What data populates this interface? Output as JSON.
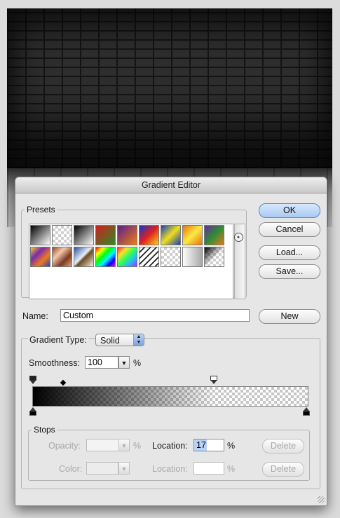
{
  "dialog": {
    "title": "Gradient Editor"
  },
  "presets": {
    "legend": "Presets",
    "menu_glyph": "▸",
    "swatches": [
      {
        "name": "foreground-to-background",
        "bg": "linear-gradient(135deg,#000 0%,#fff 100%)"
      },
      {
        "name": "foreground-to-transparent",
        "bg": "checker"
      },
      {
        "name": "black-white",
        "bg": "linear-gradient(135deg,#000,#fff)"
      },
      {
        "name": "red-green",
        "bg": "linear-gradient(135deg,#d02020,#2d8a22)"
      },
      {
        "name": "violet-orange",
        "bg": "linear-gradient(135deg,#5a1e8c,#f07d12)"
      },
      {
        "name": "blue-red-yellow",
        "bg": "linear-gradient(135deg,#1535c6,#e02020,#f5d21a)"
      },
      {
        "name": "blue-yellow-blue",
        "bg": "linear-gradient(135deg,#1540b8,#f0de1c,#1540b8)"
      },
      {
        "name": "orange-yellow-orange",
        "bg": "linear-gradient(135deg,#e8740c,#fbe944,#e8740c)"
      },
      {
        "name": "violet-green-orange",
        "bg": "linear-gradient(135deg,#6b2a9c,#2e8c36,#e47a1c)"
      },
      {
        "name": "yellow-violet-orange-blue",
        "bg": "linear-gradient(135deg,#f2d21a,#7a2ab0,#ef7a18,#1a48c8)"
      },
      {
        "name": "copper",
        "bg": "linear-gradient(135deg,#8a4a2a,#f4c9a9,#7a3a22,#e0a07c)"
      },
      {
        "name": "chrome",
        "bg": "linear-gradient(135deg,#2a4ea0,#e8eef8 45%,#6b4a22 55%,#f6f0e0)"
      },
      {
        "name": "spectrum",
        "bg": "linear-gradient(135deg,#ff0000,#ffff00,#00ff00,#00ffff,#0000ff,#ff00ff)"
      },
      {
        "name": "transparent-rainbow",
        "bg": "linear-gradient(135deg,#ff2a2a,#ffe12a,#2aff5a,#2ab4ff,#b42aff)"
      },
      {
        "name": "transparent-stripes",
        "bg": "repeating-linear-gradient(135deg,#fff 0 4px,#222 4px 6px)"
      },
      {
        "name": "neutral-density",
        "bg": "checker"
      },
      {
        "name": "white-to-gray",
        "bg": "linear-gradient(90deg,#fdfdfd,#a8a8a8)"
      },
      {
        "name": "black-to-transparent",
        "bg": "linear-gradient(135deg,#000 0%,rgba(0,0,0,0) 55%)"
      }
    ]
  },
  "buttons": {
    "ok": "OK",
    "cancel": "Cancel",
    "load": "Load...",
    "save": "Save...",
    "new": "New"
  },
  "name_field": {
    "label": "Name:",
    "value": "Custom"
  },
  "gradient_type": {
    "label": "Gradient Type:",
    "selected": "Solid",
    "smoothness_label": "Smoothness:",
    "smoothness_value": "100",
    "smoothness_unit": "%"
  },
  "stops": {
    "legend": "Stops",
    "opacity_label": "Opacity:",
    "opacity_value": "",
    "opacity_unit": "%",
    "color_label": "Color:",
    "location_label": "Location:",
    "location_value_top": "17",
    "location_unit": "%",
    "location_value_bottom": "",
    "delete_label": "Delete"
  },
  "gradient": {
    "color_start": "#000000",
    "color_end": "#000000",
    "opacity_start_percent": 100,
    "opacity_end_percent": 0,
    "opacity_stop_positions_percent": [
      0,
      66
    ],
    "color_stop_positions_percent": [
      0,
      100
    ],
    "midpoint_percent": 11
  },
  "colors": {
    "default_button": "#a9c9f3",
    "dialog_bg": "#e6e6e6"
  }
}
